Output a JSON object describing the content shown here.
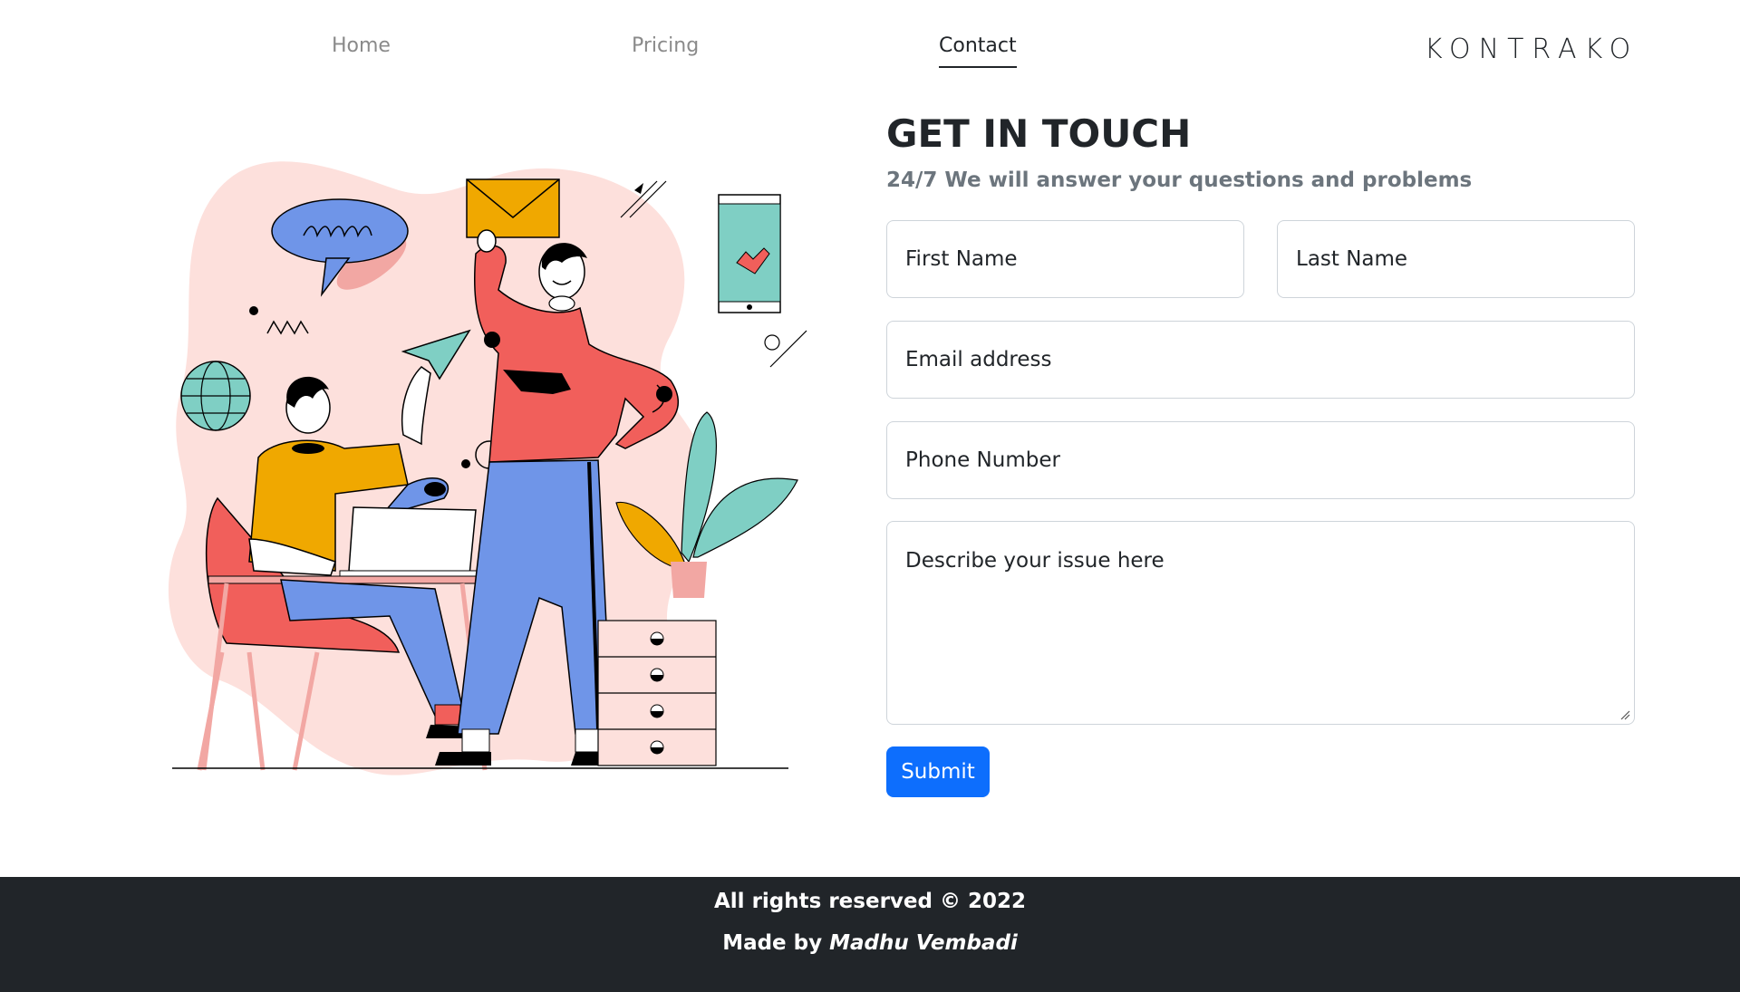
{
  "nav": {
    "home": "Home",
    "pricing": "Pricing",
    "contact": "Contact",
    "brand": "KONTRAKO"
  },
  "form": {
    "title_regular": "GET IN ",
    "title_bold": "TOUCH",
    "subtitle": "24/7 We will answer your questions and problems",
    "first_name": "First Name",
    "last_name": "Last Name",
    "email": "Email address",
    "phone": "Phone Number",
    "issue": "Describe your issue here",
    "submit": "Submit"
  },
  "footer": {
    "rights": "All rights reserved © 2022",
    "made_by_prefix": "Made by ",
    "author": "Madhu Vembadi"
  },
  "colors": {
    "primary": "#0d6efd",
    "footer_bg": "#212529",
    "blob": "#fde0dc",
    "shirt_red": "#f15f5b",
    "pants_blue": "#6f95e8",
    "yellow": "#f0a800",
    "teal": "#7fcfc4"
  }
}
